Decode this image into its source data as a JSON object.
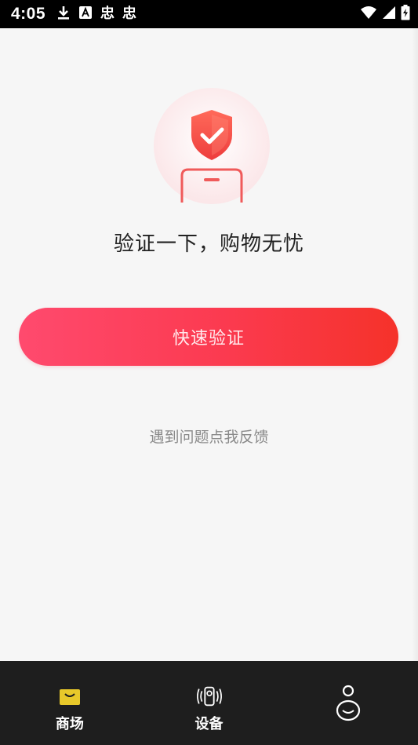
{
  "status_bar": {
    "time": "4:05",
    "icons": [
      "download-icon",
      "a-notification-icon",
      "app-notification-icon",
      "app-notification-icon",
      "wifi-icon",
      "signal-icon",
      "battery-charging-icon"
    ],
    "app_glyph": "忠"
  },
  "main": {
    "hero_icon": "shield-check-phone-icon",
    "headline": "验证一下，购物无忧",
    "verify_button_label": "快速验证",
    "feedback_link": "遇到问题点我反馈"
  },
  "tab_bar": {
    "items": [
      {
        "label": "商场",
        "icon": "shopping-bag-icon",
        "active": true
      },
      {
        "label": "设备",
        "icon": "device-icon",
        "active": false
      },
      {
        "label": "",
        "icon": "profile-icon",
        "active": false
      }
    ]
  },
  "colors": {
    "accent": "#fb3a4f",
    "button_gradient_start": "#ff4a6e",
    "button_gradient_end": "#f5322a",
    "active_tab_icon": "#e8c82a",
    "tab_bar_bg": "#1e1e1e",
    "background": "#f6f6f6"
  }
}
